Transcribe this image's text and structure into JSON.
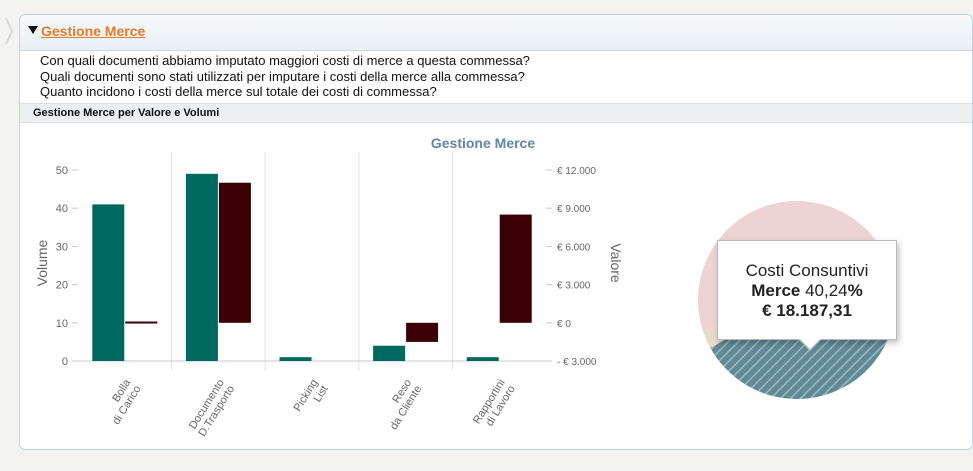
{
  "section": {
    "title": "Gestione Merce",
    "questions": [
      "Con quali documenti abbiamo imputato maggiori costi di merce a questa commessa?",
      "Quali documenti sono stati utilizzati per imputare i costi della merce alla commessa?",
      "Quanto incidono i costi della merce sul totale dei costi di commessa?"
    ],
    "subheader": "Gestione Merce per Valore e Volumi"
  },
  "colors": {
    "volume": "#00695f",
    "valore": "#3a0006",
    "title": "#5f87a8",
    "pie_main": "#eed3d3",
    "pie_merce": "#5f8a96",
    "pie_other": "#e6dcc8"
  },
  "chart_data": [
    {
      "type": "bar",
      "title": "Gestione Merce",
      "categories": [
        [
          "Bolla",
          "di Carico"
        ],
        [
          "Documento",
          "D.Trasporto"
        ],
        [
          "Picking",
          "List"
        ],
        [
          "Reso",
          "da Cliente"
        ],
        [
          "Rapportini",
          "di Lavoro"
        ]
      ],
      "ylabel": "Volume",
      "y2label": "Valore",
      "ylim": [
        0,
        50
      ],
      "y_ticks": [
        "0",
        "10",
        "20",
        "30",
        "40",
        "50"
      ],
      "y2lim": [
        -3000,
        12000
      ],
      "y2_ticks": [
        "- € 3.000",
        "€ 0",
        "€ 3.000",
        "€ 6.000",
        "€ 9.000",
        "€ 12.000"
      ],
      "series": [
        {
          "name": "Volume",
          "axis": "left",
          "values": [
            41,
            49,
            1,
            4,
            1
          ]
        },
        {
          "name": "Valore",
          "axis": "right",
          "values": [
            100,
            11000,
            0,
            -1500,
            8500
          ]
        }
      ]
    },
    {
      "type": "pie",
      "slices": [
        {
          "label": "Merce",
          "value": 40.24
        },
        {
          "label": "",
          "value": 56.76
        },
        {
          "label": "",
          "value": 3.0
        }
      ],
      "tooltip": {
        "line1": "Costi Consuntivi",
        "series": "Merce",
        "percent": "40,24",
        "percent_sign": "%",
        "amount": "€ 18.187,31"
      }
    }
  ]
}
